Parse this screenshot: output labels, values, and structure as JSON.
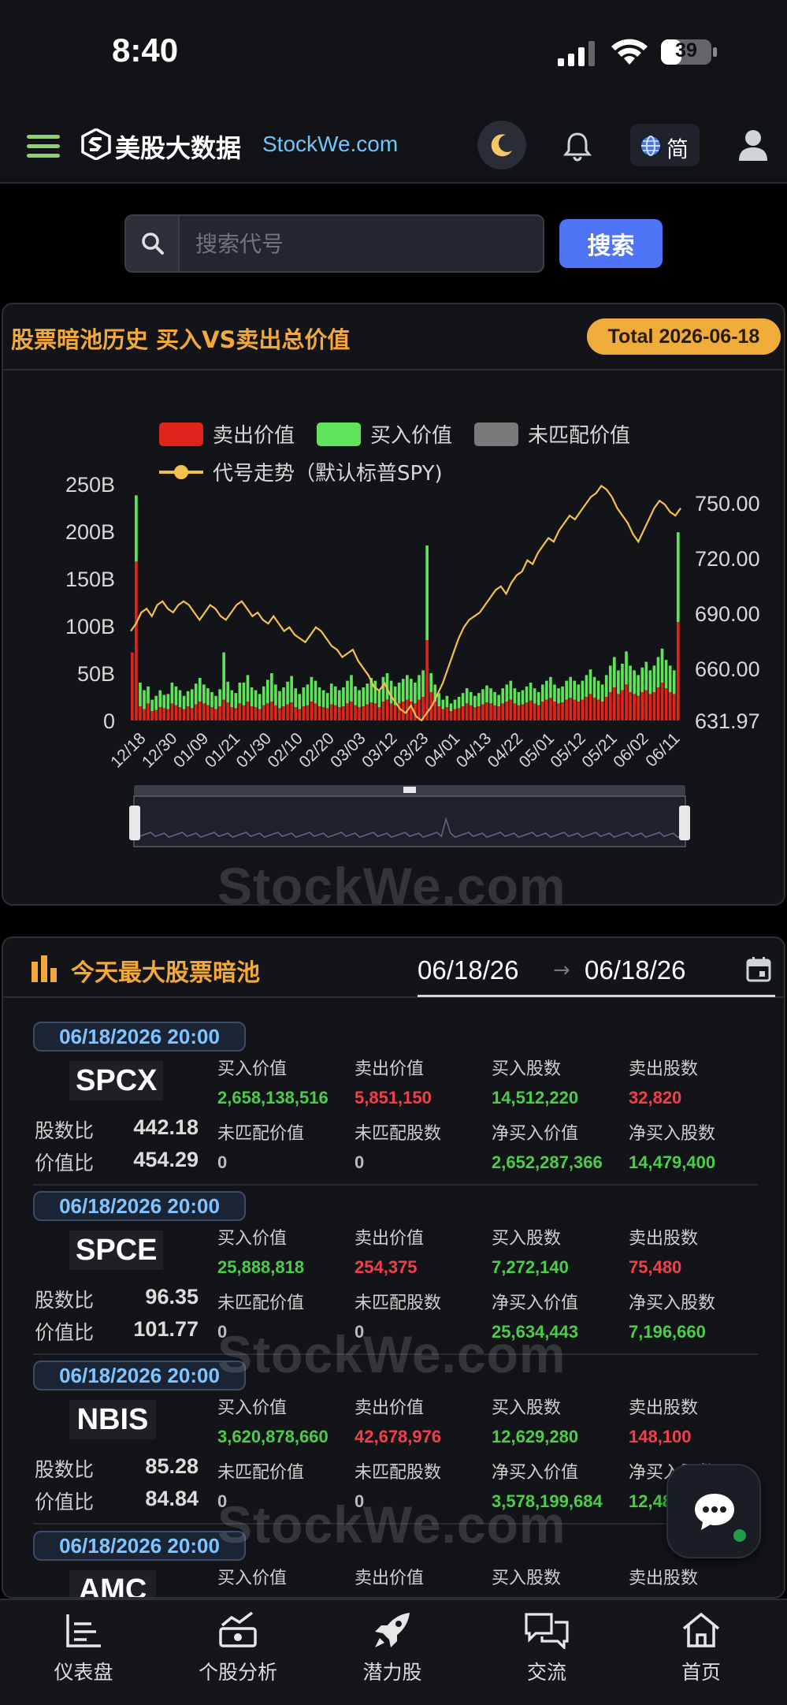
{
  "status": {
    "time": "8:40",
    "battery": "39"
  },
  "header": {
    "logo_cn": "美股大数据",
    "logo_en": "StockWe.com",
    "lang_label": "简"
  },
  "search": {
    "placeholder": "搜索代号",
    "button_label": "搜索"
  },
  "darkpool_history": {
    "title": "股票暗池历史 买入VS卖出总价值",
    "total_badge": "Total 2026-06-18",
    "legend": {
      "sell": "卖出价值",
      "buy": "买入价值",
      "unmatched": "未匹配价值",
      "trend": "代号走势（默认标普SPY)"
    },
    "watermark": "StockWe.com"
  },
  "chart_data": {
    "type": "bar",
    "title": "股票暗池历史 买入VS卖出总价值",
    "colors": {
      "sell": "#e0241c",
      "buy": "#5fe35a",
      "unmatched": "#7a7a7a",
      "trend": "#f2c14e"
    },
    "y_left": {
      "ticks": [
        "250B",
        "200B",
        "150B",
        "100B",
        "50B",
        "0"
      ],
      "range": [
        0,
        250
      ]
    },
    "y_right": {
      "ticks": [
        "750.00",
        "720.00",
        "690.00",
        "660.00",
        "631.97"
      ],
      "range": [
        631.97,
        759
      ]
    },
    "x_labels": [
      "12/18",
      "12/30",
      "01/09",
      "01/21",
      "01/30",
      "02/10",
      "02/20",
      "03/03",
      "03/12",
      "03/23",
      "04/01",
      "04/13",
      "04/22",
      "05/01",
      "05/12",
      "05/21",
      "06/02",
      "06/11"
    ],
    "series": [
      {
        "name": "卖出价值",
        "values_B": [
          72,
          168,
          15,
          12,
          18,
          10,
          11,
          14,
          13,
          12,
          18,
          16,
          14,
          12,
          15,
          13,
          17,
          20,
          18,
          16,
          14,
          12,
          15,
          22,
          19,
          14,
          13,
          18,
          16,
          20,
          15,
          14,
          12,
          16,
          18,
          20,
          16,
          13,
          15,
          17,
          19,
          14,
          12,
          15,
          16,
          20,
          18,
          15,
          14,
          13,
          17,
          16,
          14,
          15,
          18,
          20,
          16,
          14,
          15,
          17,
          19,
          18,
          14,
          20,
          22,
          18,
          16,
          18,
          20,
          22,
          20,
          18,
          22,
          25,
          85,
          30,
          20,
          15,
          12,
          14,
          10,
          12,
          13,
          15,
          18,
          16,
          14,
          15,
          17,
          19,
          18,
          16,
          15,
          18,
          20,
          22,
          18,
          16,
          17,
          19,
          21,
          18,
          16,
          20,
          22,
          24,
          20,
          18,
          19,
          22,
          24,
          22,
          20,
          22,
          25,
          28,
          24,
          22,
          20,
          25,
          30,
          35,
          28,
          32,
          38,
          30,
          28,
          26,
          30,
          32,
          28,
          30,
          35,
          40,
          34,
          30,
          28,
          104
        ]
      },
      {
        "name": "买入价值",
        "values_B": [
          0,
          70,
          25,
          20,
          18,
          12,
          15,
          18,
          14,
          16,
          22,
          20,
          18,
          14,
          16,
          20,
          22,
          25,
          20,
          18,
          16,
          14,
          18,
          50,
          22,
          18,
          16,
          22,
          24,
          28,
          20,
          18,
          16,
          20,
          25,
          30,
          22,
          18,
          20,
          24,
          28,
          20,
          16,
          20,
          22,
          26,
          24,
          20,
          18,
          16,
          22,
          20,
          18,
          20,
          24,
          28,
          20,
          18,
          20,
          22,
          26,
          24,
          18,
          26,
          28,
          24,
          20,
          22,
          24,
          26,
          24,
          22,
          26,
          28,
          100,
          20,
          18,
          14,
          10,
          12,
          8,
          10,
          12,
          14,
          16,
          14,
          12,
          14,
          16,
          18,
          16,
          14,
          12,
          16,
          18,
          20,
          16,
          14,
          15,
          17,
          19,
          16,
          14,
          18,
          20,
          22,
          18,
          16,
          17,
          20,
          22,
          20,
          18,
          20,
          23,
          26,
          22,
          20,
          18,
          23,
          28,
          32,
          25,
          28,
          35,
          28,
          25,
          22,
          26,
          30,
          25,
          28,
          32,
          36,
          30,
          28,
          25,
          95
        ]
      },
      {
        "name": "代号走势（默认标普SPY)",
        "description": "price line from ~680 at 12/18, ~690 through 02/20, dipping to ~632 near 04/01, rising to ~759 near 06/02, ending ~745"
      }
    ]
  },
  "today": {
    "title": "今天最大股票暗池",
    "date_from": "06/18/26",
    "date_to": "06/18/26",
    "labels": {
      "share_ratio": "股数比",
      "value_ratio": "价值比",
      "buy_value": "买入价值",
      "sell_value": "卖出价值",
      "buy_shares": "买入股数",
      "sell_shares": "卖出股数",
      "unmatched_value": "未匹配价值",
      "unmatched_shares": "未匹配股数",
      "net_buy_value": "净买入价值",
      "net_buy_shares": "净买入股数"
    },
    "entries": [
      {
        "datetime": "06/18/2026 20:00",
        "ticker": "SPCX",
        "share_ratio": "442.18",
        "value_ratio": "454.29",
        "buy_value": "2,658,138,516",
        "sell_value": "5,851,150",
        "buy_shares": "14,512,220",
        "sell_shares": "32,820",
        "unmatched_value": "0",
        "unmatched_shares": "0",
        "net_buy_value": "2,652,287,366",
        "net_buy_shares": "14,479,400"
      },
      {
        "datetime": "06/18/2026 20:00",
        "ticker": "SPCE",
        "share_ratio": "96.35",
        "value_ratio": "101.77",
        "buy_value": "25,888,818",
        "sell_value": "254,375",
        "buy_shares": "7,272,140",
        "sell_shares": "75,480",
        "unmatched_value": "0",
        "unmatched_shares": "0",
        "net_buy_value": "25,634,443",
        "net_buy_shares": "7,196,660"
      },
      {
        "datetime": "06/18/2026 20:00",
        "ticker": "NBIS",
        "share_ratio": "85.28",
        "value_ratio": "84.84",
        "buy_value": "3,620,878,660",
        "sell_value": "42,678,976",
        "buy_shares": "12,629,280",
        "sell_shares": "148,100",
        "unmatched_value": "0",
        "unmatched_shares": "0",
        "net_buy_value": "3,578,199,684",
        "net_buy_shares": "12,48"
      },
      {
        "datetime": "06/18/2026 20:00",
        "ticker": "AMC",
        "buy_value_label_only": true
      }
    ]
  },
  "tabbar": [
    {
      "label": "仪表盘",
      "icon": "dashboard-icon"
    },
    {
      "label": "个股分析",
      "icon": "stock-analysis-icon"
    },
    {
      "label": "潜力股",
      "icon": "rocket-icon"
    },
    {
      "label": "交流",
      "icon": "chat-icon"
    },
    {
      "label": "首页",
      "icon": "home-icon"
    }
  ]
}
